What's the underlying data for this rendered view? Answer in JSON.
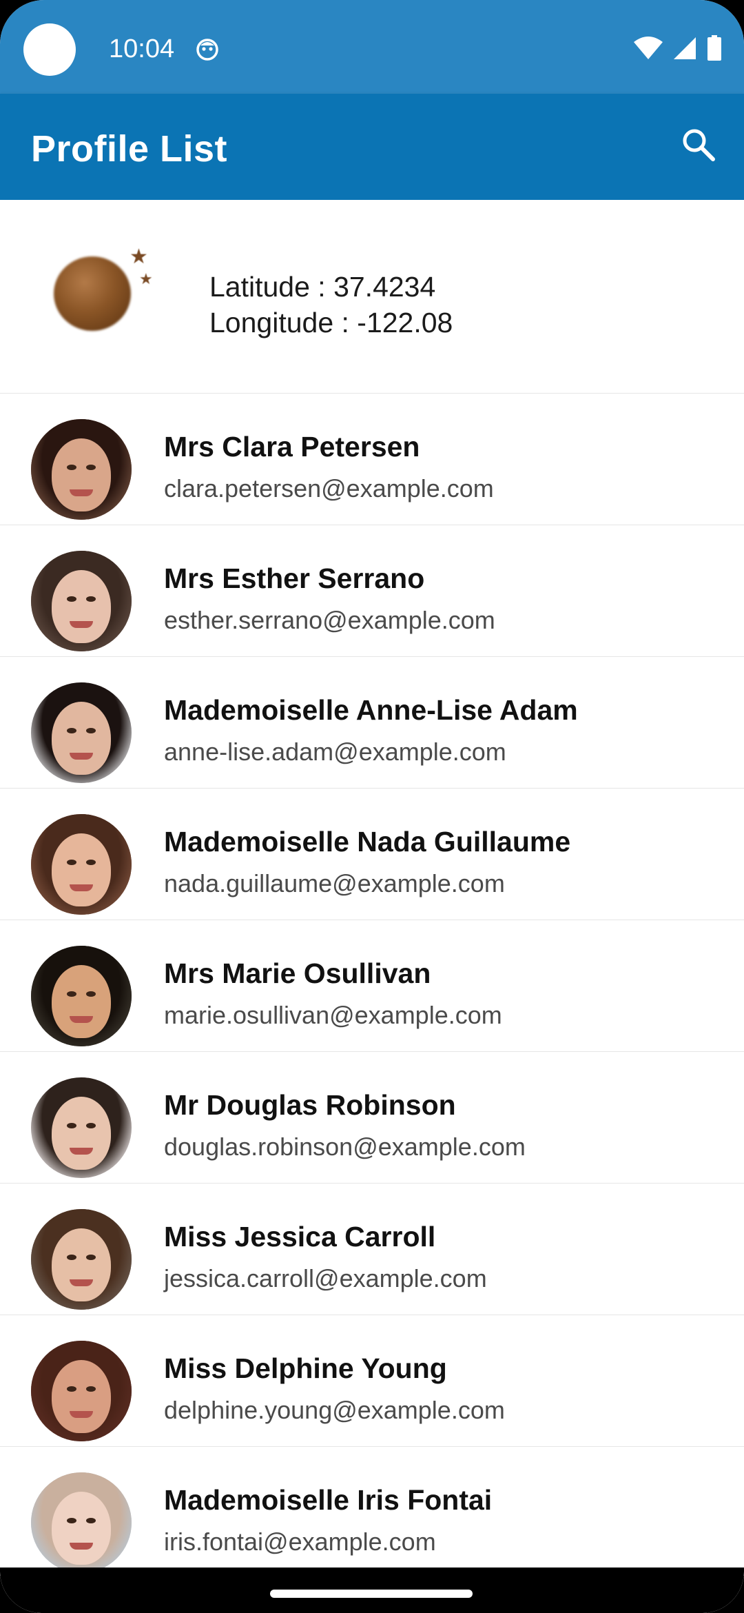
{
  "status_bar": {
    "time": "10:04",
    "icons": [
      "app-notification-icon",
      "wifi-icon",
      "cellular-signal-icon",
      "battery-icon"
    ]
  },
  "app_bar": {
    "title": "Profile List",
    "search_icon": "search-icon"
  },
  "location": {
    "latitude_text": "Latitude : 37.4234",
    "longitude_text": "Longitude : -122.08",
    "illustration": "planet-stars-image"
  },
  "profiles": [
    {
      "name": "Mrs Clara Petersen",
      "email": "clara.petersen@example.com",
      "skin": "#d9a68a",
      "hair": "#2a1610",
      "bg": "#6b4a3a"
    },
    {
      "name": "Mrs Esther Serrano",
      "email": "esther.serrano@example.com",
      "skin": "#e7c1ad",
      "hair": "#3b2a22",
      "bg": "#5e4a40"
    },
    {
      "name": "Mademoiselle Anne-Lise Adam",
      "email": "anne-lise.adam@example.com",
      "skin": "#e1b79f",
      "hair": "#1b1210",
      "bg": "#d7d7d9"
    },
    {
      "name": "Mademoiselle Nada Guillaume",
      "email": "nada.guillaume@example.com",
      "skin": "#e6b69a",
      "hair": "#4a2a1c",
      "bg": "#7a4e3a"
    },
    {
      "name": "Mrs Marie Osullivan",
      "email": "marie.osullivan@example.com",
      "skin": "#d8a27a",
      "hair": "#17110c",
      "bg": "#3a352c"
    },
    {
      "name": "Mr Douglas Robinson",
      "email": "douglas.robinson@example.com",
      "skin": "#e8c4ae",
      "hair": "#2e221c",
      "bg": "#e9e3e3"
    },
    {
      "name": "Miss Jessica Carroll",
      "email": "jessica.carroll@example.com",
      "skin": "#e6bfa6",
      "hair": "#4b3020",
      "bg": "#6a5a4f"
    },
    {
      "name": "Miss Delphine Young",
      "email": "delphine.young@example.com",
      "skin": "#d99e82",
      "hair": "#4a2318",
      "bg": "#5a2c22"
    },
    {
      "name": "Mademoiselle Iris Fontai",
      "email": "iris.fontai@example.com",
      "skin": "#efd2c3",
      "hair": "#c9b09e",
      "bg": "#b8c6d2"
    }
  ],
  "colors": {
    "status_bar": "#2a86c2",
    "app_bar": "#0b74b4",
    "background": "#ffffff"
  }
}
